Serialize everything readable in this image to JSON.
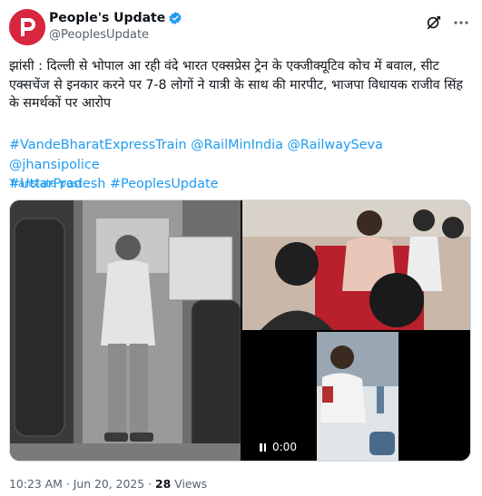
{
  "author": {
    "display_name": "People's Update",
    "handle": "@PeoplesUpdate",
    "verified": true,
    "avatar_icon": "peoples-update-logo",
    "avatar_color": "#d7263d"
  },
  "post": {
    "text": "झांसी : दिल्ली से भोपाल आ रही वंदे भारत एक्सप्रेस ट्रेन के एक्जीक्यूटिव कोच में बवाल, सीट एक्सचेंज से इनकार करने पर 7-8 लोगों ने यात्री के साथ की मारपीट, भाजपा विधायक राजीव सिंह के समर्थकों पर आरोप",
    "hashtags": [
      "#VandeBharatExpressTrain",
      "@RailMinIndia",
      "@RailwaySeva",
      "@jhansipolice",
      "#UttarPradesh",
      "#PeoplesUpdate"
    ],
    "translate_label": "Translate post"
  },
  "media": {
    "video_time": "0:00",
    "images": [
      "train-aisle-photo",
      "passengers-photo",
      "video-thumbnail"
    ]
  },
  "meta": {
    "time": "10:23 AM",
    "separator": "·",
    "date": "Jun 20, 2025",
    "views_count": "28",
    "views_label": "Views"
  },
  "colors": {
    "link": "#1d9bf0",
    "text": "#0f1419",
    "muted": "#536471",
    "verified": "#1d9bf0"
  }
}
